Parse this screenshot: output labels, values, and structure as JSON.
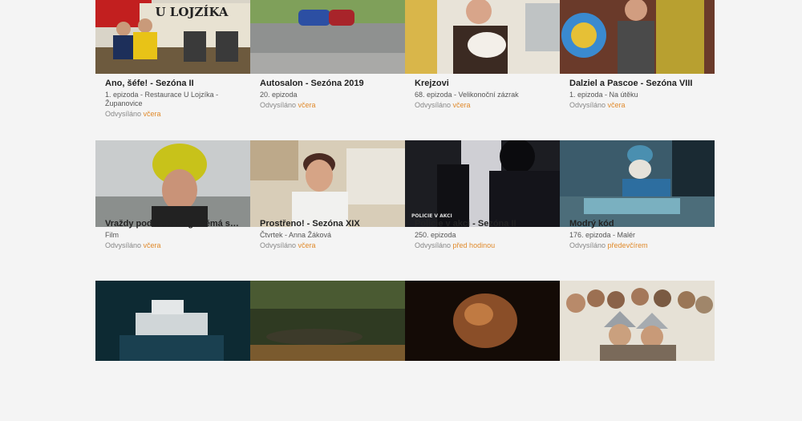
{
  "accent_color": "#e08a2c",
  "cards": [
    {
      "title": "Ano, šéfe! - Sezóna II",
      "subtitle": "1. epizoda - Restaurace U Lojzíka - Županovice",
      "aired_label": "Odvysíláno",
      "aired_when": "včera",
      "thumb_text": "U LOJZÍKA"
    },
    {
      "title": "Autosalon - Sezóna 2019",
      "subtitle": "20. epizoda",
      "aired_label": "Odvysíláno",
      "aired_when": "včera"
    },
    {
      "title": "Krejzovi",
      "subtitle": "68. epizoda - Velikonoční zázrak",
      "aired_label": "Odvysíláno",
      "aired_when": "včera"
    },
    {
      "title": "Dalziel a Pascoe - Sezóna VIII",
      "subtitle": "1. epizoda - Na útěku",
      "aired_label": "Odvysíláno",
      "aired_when": "včera"
    },
    {
      "title": "Vraždy podle Solveig: Němá svědkyně",
      "subtitle": "Film",
      "aired_label": "Odvysíláno",
      "aired_when": "včera"
    },
    {
      "title": "Prostřeno! - Sezóna XIX",
      "subtitle": "Čtvrtek - Anna Žáková",
      "aired_label": "Odvysíláno",
      "aired_when": "včera"
    },
    {
      "title": "Policie v akci - Sezóna II",
      "subtitle": "250. epizoda",
      "aired_label": "Odvysíláno",
      "aired_when": "před hodinou",
      "thumb_text": "POLICIE V AKCI"
    },
    {
      "title": "Modrý kód",
      "subtitle": "176. epizoda - Malér",
      "aired_label": "Odvysíláno",
      "aired_when": "předevčírem"
    },
    {
      "title": "",
      "subtitle": "",
      "aired_label": "",
      "aired_when": ""
    },
    {
      "title": "",
      "subtitle": "",
      "aired_label": "",
      "aired_when": ""
    },
    {
      "title": "",
      "subtitle": "",
      "aired_label": "",
      "aired_when": ""
    },
    {
      "title": "",
      "subtitle": "",
      "aired_label": "",
      "aired_when": ""
    }
  ]
}
